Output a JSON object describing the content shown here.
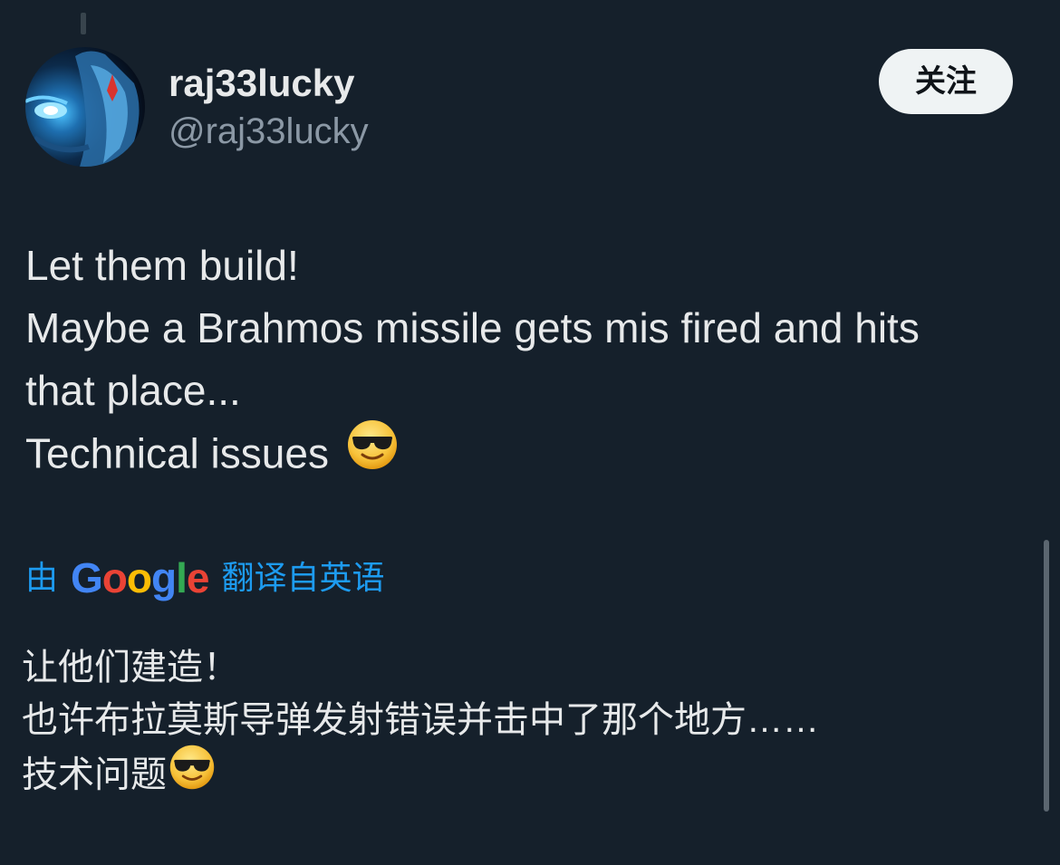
{
  "user": {
    "display_name": "raj33lucky",
    "handle": "@raj33lucky",
    "follow_label": "关注"
  },
  "tweet": {
    "lines": [
      "Let them build!",
      "Maybe a Brahmos missile gets mis fired and hits",
      "that place...",
      "Technical issues"
    ],
    "emoji": "smiling-face-with-sunglasses-icon"
  },
  "translation": {
    "prefix": "由",
    "provider": [
      "G",
      "o",
      "o",
      "g",
      "l",
      "e"
    ],
    "suffix": "翻译自英语",
    "lines": [
      "让他们建造！",
      "也许布拉莫斯导弹发射错误并击中了那个地方……",
      "技术问题"
    ]
  },
  "colors": {
    "background": "#15202b",
    "text": "#e7e9ea",
    "secondary_text": "#8b98a5",
    "link": "#1d9bf0",
    "google_blue": "#4285f4",
    "google_red": "#ea4335",
    "google_yellow": "#fbbc05",
    "google_green": "#34a853"
  }
}
